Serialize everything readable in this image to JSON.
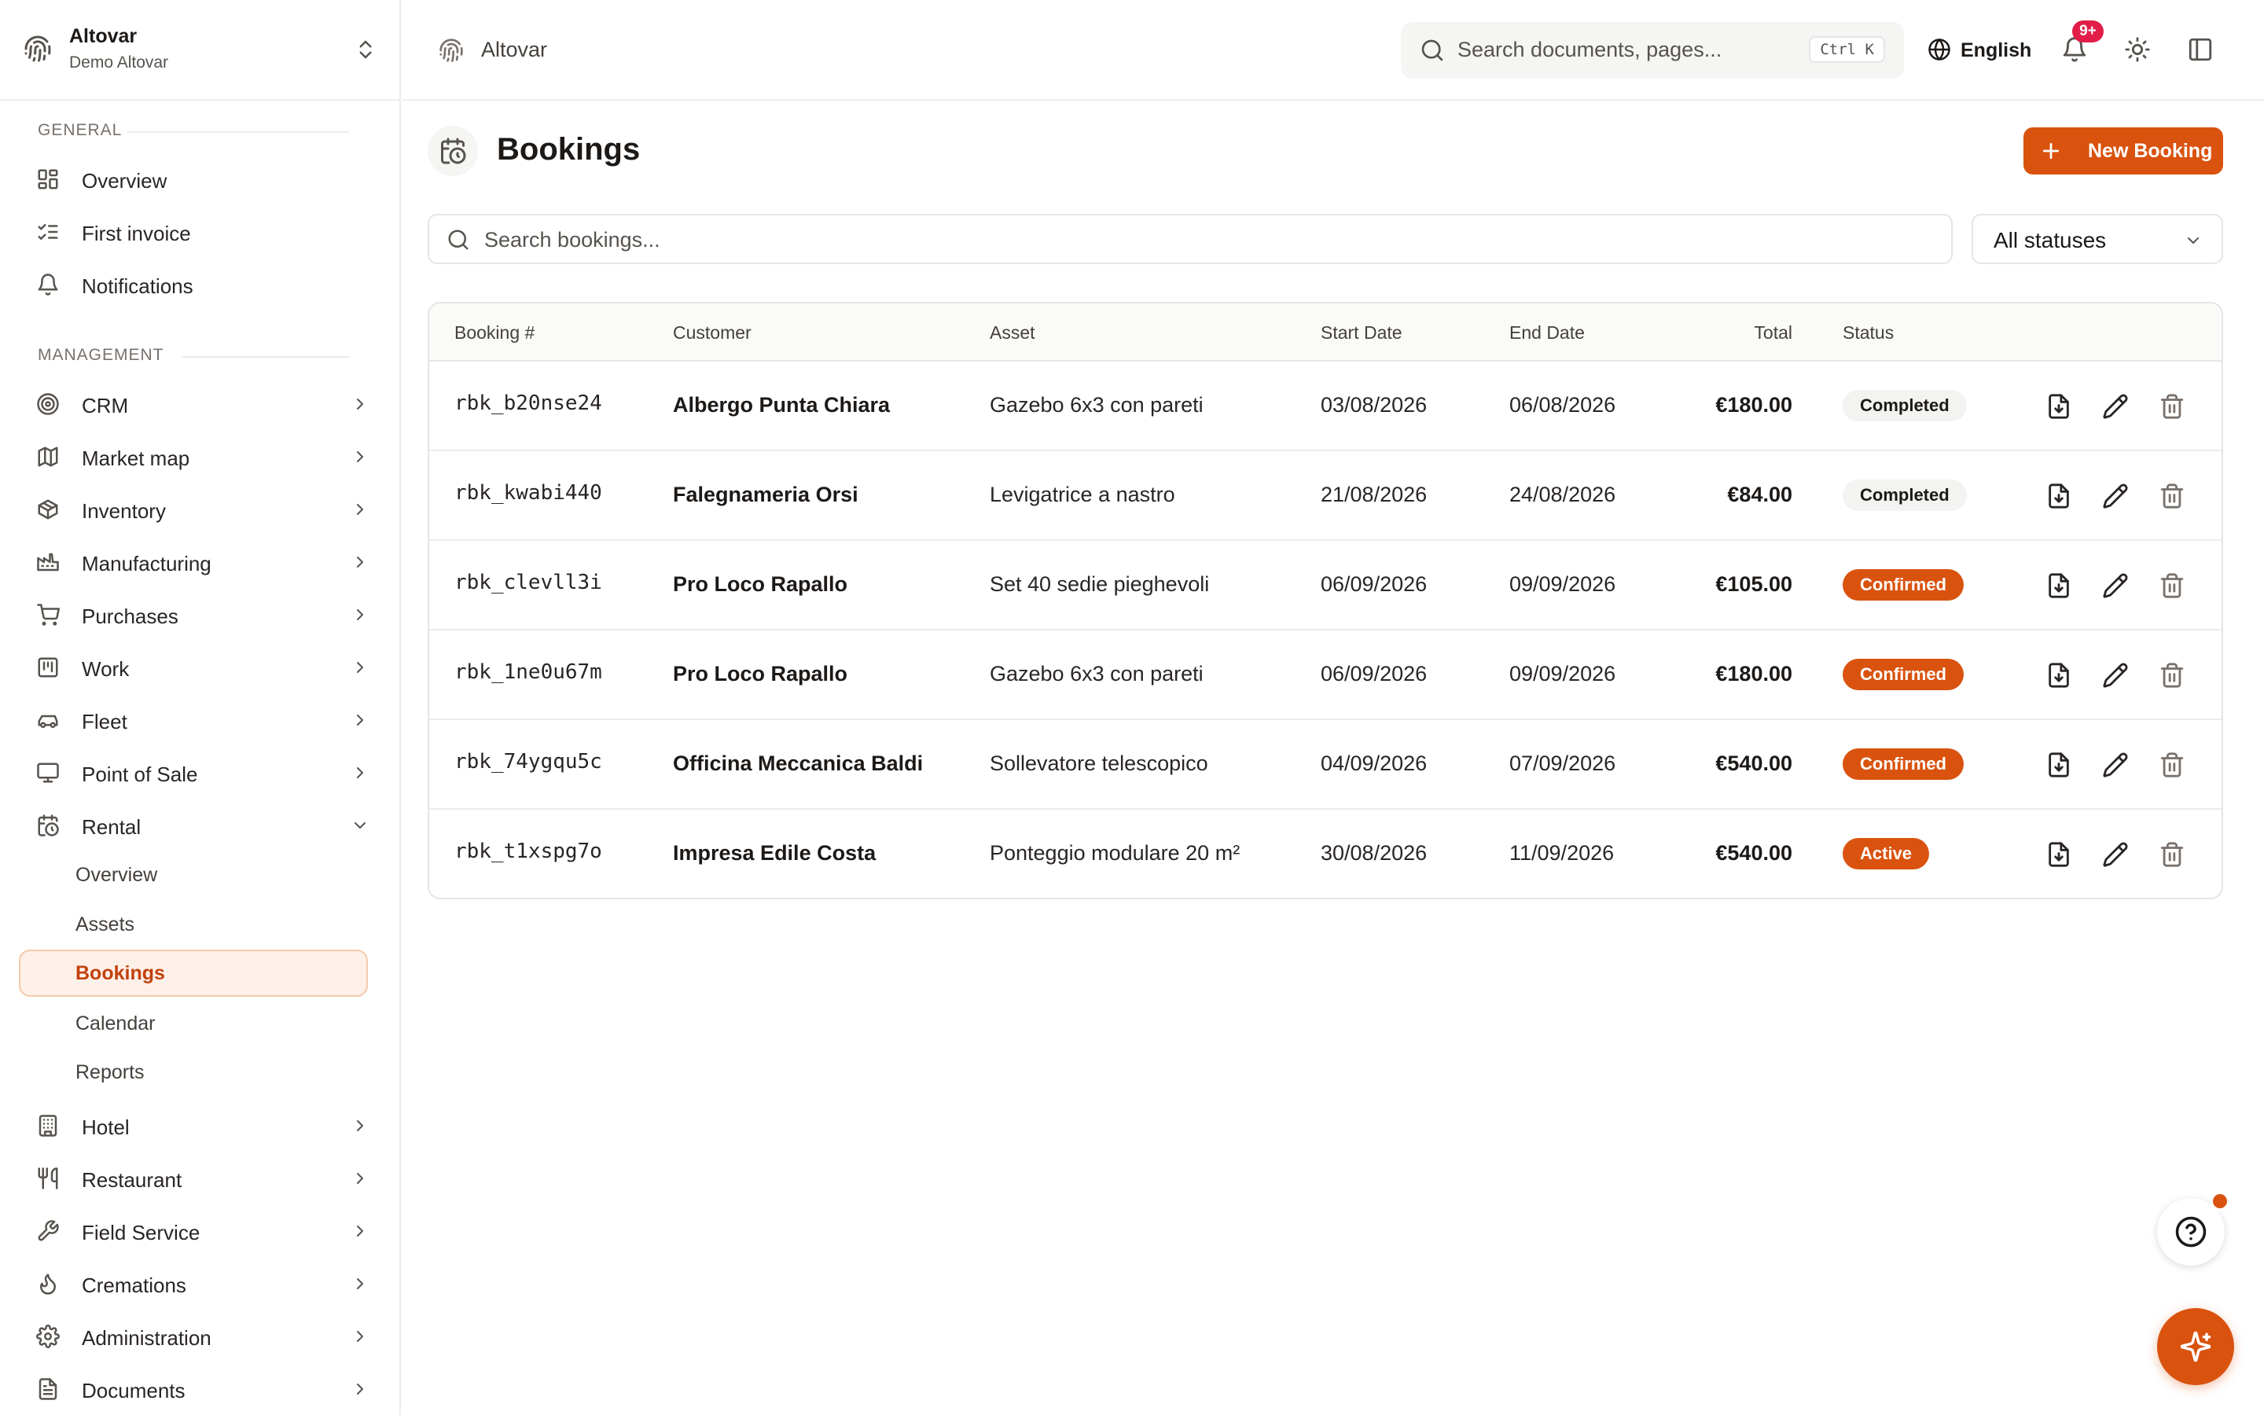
{
  "org": {
    "name": "Altovar",
    "subtitle": "Demo Altovar"
  },
  "topbar": {
    "breadcrumb": "Altovar",
    "search_placeholder": "Search documents, pages...",
    "search_shortcut": "Ctrl K",
    "language": "English",
    "notifications_badge": "9+"
  },
  "sidebar": {
    "general_title": "General",
    "general": [
      {
        "label": "Overview",
        "icon": "grid-icon"
      },
      {
        "label": "First invoice",
        "icon": "checklist-icon"
      },
      {
        "label": "Notifications",
        "icon": "bell-icon"
      }
    ],
    "management_title": "Management",
    "management": [
      {
        "label": "CRM",
        "icon": "target-icon"
      },
      {
        "label": "Market map",
        "icon": "map-icon"
      },
      {
        "label": "Inventory",
        "icon": "box-icon"
      },
      {
        "label": "Manufacturing",
        "icon": "factory-icon"
      },
      {
        "label": "Purchases",
        "icon": "cart-icon"
      },
      {
        "label": "Work",
        "icon": "kanban-icon"
      },
      {
        "label": "Fleet",
        "icon": "car-icon"
      },
      {
        "label": "Point of Sale",
        "icon": "monitor-icon"
      },
      {
        "label": "Rental",
        "icon": "calendar-clock-icon"
      }
    ],
    "rental_sub": [
      {
        "label": "Overview"
      },
      {
        "label": "Assets"
      },
      {
        "label": "Bookings"
      },
      {
        "label": "Calendar"
      },
      {
        "label": "Reports"
      }
    ],
    "after": [
      {
        "label": "Hotel",
        "icon": "building-icon"
      },
      {
        "label": "Restaurant",
        "icon": "utensils-icon"
      },
      {
        "label": "Field Service",
        "icon": "wrench-icon"
      },
      {
        "label": "Cremations",
        "icon": "flame-icon"
      },
      {
        "label": "Administration",
        "icon": "gear-icon"
      },
      {
        "label": "Documents",
        "icon": "document-icon"
      }
    ]
  },
  "page": {
    "title": "Bookings",
    "new_button": "New Booking",
    "search_placeholder": "Search bookings...",
    "status_filter": "All statuses"
  },
  "table": {
    "headers": {
      "booking": "Booking #",
      "customer": "Customer",
      "asset": "Asset",
      "start": "Start Date",
      "end": "End Date",
      "total": "Total",
      "status": "Status"
    },
    "rows": [
      {
        "id": "rbk_b20nse24",
        "customer": "Albergo Punta Chiara",
        "asset": "Gazebo 6x3 con pareti",
        "start": "03/08/2026",
        "end": "06/08/2026",
        "total": "€180.00",
        "status": "Completed"
      },
      {
        "id": "rbk_kwabi440",
        "customer": "Falegnameria Orsi",
        "asset": "Levigatrice a nastro",
        "start": "21/08/2026",
        "end": "24/08/2026",
        "total": "€84.00",
        "status": "Completed"
      },
      {
        "id": "rbk_clevll3i",
        "customer": "Pro Loco Rapallo",
        "asset": "Set 40 sedie pieghevoli",
        "start": "06/09/2026",
        "end": "09/09/2026",
        "total": "€105.00",
        "status": "Confirmed"
      },
      {
        "id": "rbk_1ne0u67m",
        "customer": "Pro Loco Rapallo",
        "asset": "Gazebo 6x3 con pareti",
        "start": "06/09/2026",
        "end": "09/09/2026",
        "total": "€180.00",
        "status": "Confirmed"
      },
      {
        "id": "rbk_74ygqu5c",
        "customer": "Officina Meccanica Baldi",
        "asset": "Sollevatore telescopico",
        "start": "04/09/2026",
        "end": "07/09/2026",
        "total": "€540.00",
        "status": "Confirmed"
      },
      {
        "id": "rbk_t1xspg7o",
        "customer": "Impresa Edile Costa",
        "asset": "Ponteggio modulare 20 m²",
        "start": "30/08/2026",
        "end": "11/09/2026",
        "total": "€540.00",
        "status": "Active"
      }
    ]
  },
  "colors": {
    "accent": "#d9530f",
    "accent_soft": "#fdf0e8",
    "badge": "#e11d48"
  }
}
